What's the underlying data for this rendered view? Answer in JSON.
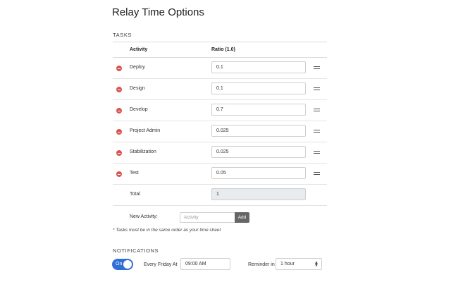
{
  "page": {
    "title": "Relay Time Options"
  },
  "tasks": {
    "section_label": "TASKS",
    "header": {
      "activity": "Activity",
      "ratio": "Ratio (1.0)"
    },
    "rows": [
      {
        "activity": "Deploy",
        "ratio": "0.1"
      },
      {
        "activity": "Design",
        "ratio": "0.1"
      },
      {
        "activity": "Develop",
        "ratio": "0.7"
      },
      {
        "activity": "Project Admin",
        "ratio": "0.025"
      },
      {
        "activity": "Stabilization",
        "ratio": "0.025"
      },
      {
        "activity": "Test",
        "ratio": "0.05"
      }
    ],
    "total": {
      "label": "Total",
      "value": "1"
    },
    "new_activity": {
      "label": "New Activity:",
      "placeholder": "Activity",
      "add_label": "Add"
    },
    "note": "* Tasks must be in the same order as your time sheet"
  },
  "notifications": {
    "section_label": "NOTIFICATIONS",
    "toggle": {
      "label": "On",
      "state": true
    },
    "every_label": "Every Friday At",
    "time_value": "09:00 AM",
    "reminder_label": "Reminder in",
    "reminder_value": "1 hour"
  },
  "colors": {
    "accent": "#2f6fd6",
    "remove": "#d9534f",
    "add_button": "#666666"
  }
}
